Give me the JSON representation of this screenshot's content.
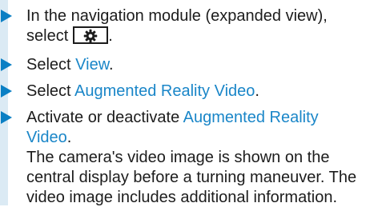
{
  "steps": [
    {
      "lines": [
        "In the navigation module (expanded view),",
        "select"
      ],
      "icon": "gear-icon",
      "trailing": "."
    },
    {
      "prefix": "Select ",
      "link": "View",
      "suffix": "."
    },
    {
      "prefix": "Select ",
      "link": "Augmented Reality Video",
      "suffix": "."
    },
    {
      "prefix": "Activate or deactivate ",
      "link_lines": [
        "Augmented Reality",
        "Video"
      ],
      "suffix": ".",
      "note_lines": [
        "The camera's video image is shown on the",
        "central display before a turning maneuver. The",
        "video image includes additional information."
      ]
    }
  ],
  "colors": {
    "bar": "#dbeaf4",
    "arrow": "#0a7fc4",
    "link": "#1a86c8",
    "text": "#1c1c1c"
  }
}
